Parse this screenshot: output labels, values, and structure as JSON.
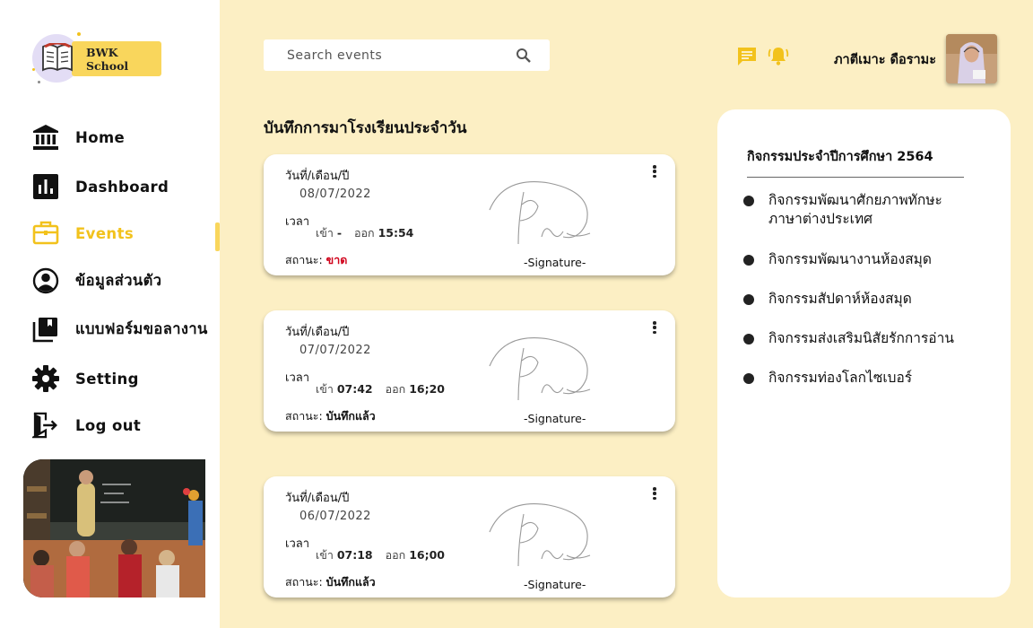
{
  "app": {
    "logo_text": "BWK School"
  },
  "sidebar": {
    "items": [
      {
        "label": "Home",
        "icon": "bank-icon"
      },
      {
        "label": "Dashboard",
        "icon": "bar-chart-icon"
      },
      {
        "label": "Events",
        "icon": "briefcase-icon",
        "active": true
      },
      {
        "label": "ข้อมูลส่วนตัว",
        "icon": "user-circle-icon"
      },
      {
        "label": "แบบฟอร์มขอลางาน",
        "icon": "library-books-icon"
      },
      {
        "label": "Setting",
        "icon": "gear-icon"
      },
      {
        "label": "Log out",
        "icon": "logout-icon"
      }
    ]
  },
  "header": {
    "search_placeholder": "Search events",
    "user_name": "ภาตีเมาะ ดือรามะ"
  },
  "attendance": {
    "title": "บันทึกการมาโรงเรียนประจำวัน",
    "date_label": "วันที่/เดือน/ปี",
    "time_label": "เวลา",
    "in_label": "เข้า",
    "out_label": "ออก",
    "status_label": "สถานะ:",
    "signature_label": "-Signature-",
    "records": [
      {
        "date": "08/07/2022",
        "time_in": "-",
        "time_out": "15:54",
        "status": "ขาด",
        "absent": true
      },
      {
        "date": "07/07/2022",
        "time_in": "07:42",
        "time_out": "16;20",
        "status": "บันทึกแล้ว",
        "absent": false
      },
      {
        "date": "06/07/2022",
        "time_in": "07:18",
        "time_out": "16;00",
        "status": "บันทึกแล้ว",
        "absent": false
      }
    ]
  },
  "activities": {
    "title": "กิจกรรมประจำปีการศึกษา 2564",
    "items": [
      "กิจกรรมพัฒนาศักยภาพทักษะภาษาต่างประเทศ",
      "กิจกรรมพัฒนางานห้องสมุด",
      "กิจกรรมสัปดาห์ห้องสมุด",
      "กิจกรรมส่งเสริมนิสัยรักการอ่าน",
      "กิจกรรมท่องโลกไซเบอร์"
    ]
  },
  "colors": {
    "background": "#fcefc4",
    "accent": "#f2c21c",
    "accent_light": "#f9d65c",
    "absent": "#d0021b"
  }
}
